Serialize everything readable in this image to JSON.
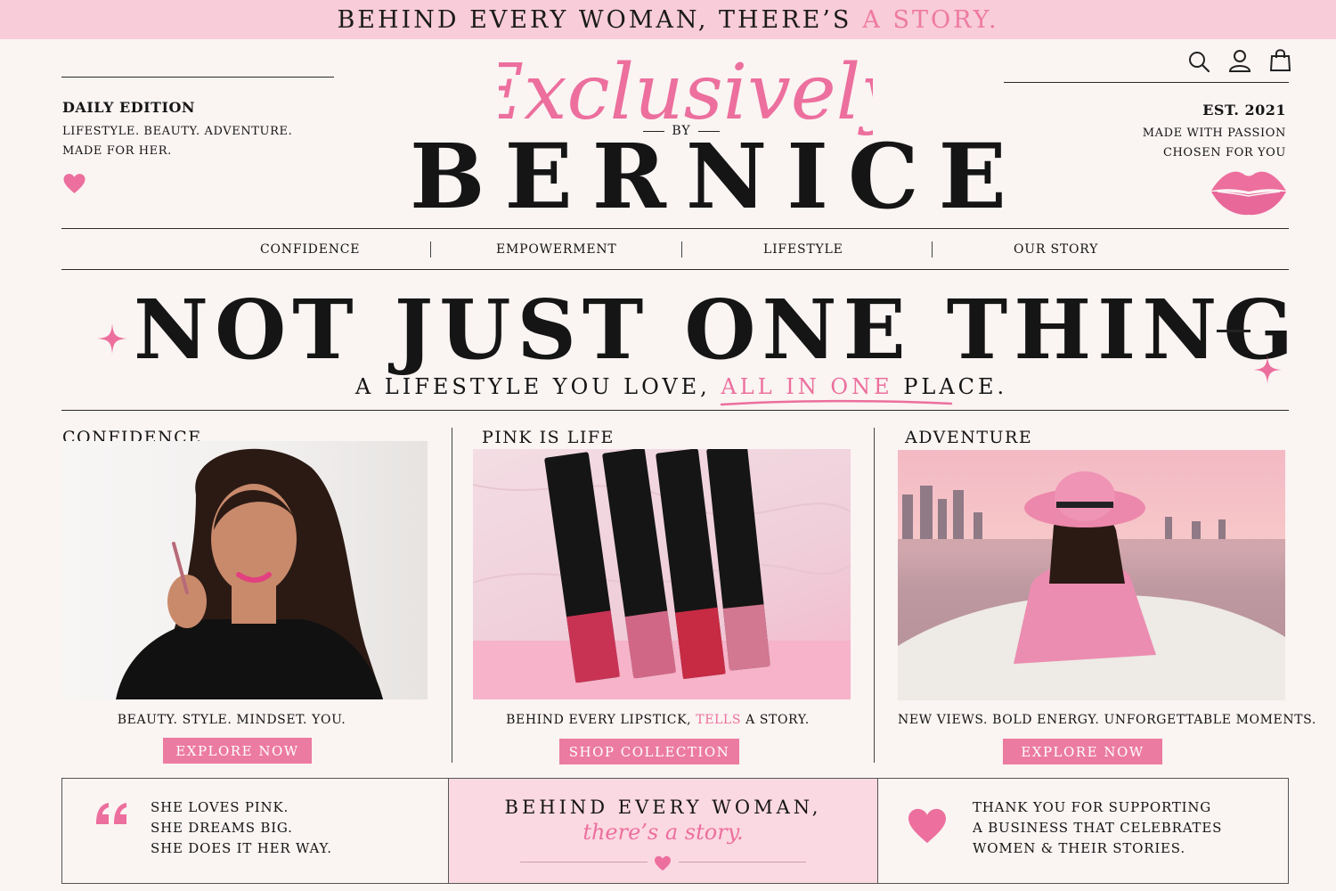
{
  "banner": {
    "text": "BEHIND EVERY WOMAN, THERE’S",
    "highlight": "A STORY."
  },
  "left_info": {
    "edition": "DAILY EDITION",
    "line1": "LIFESTYLE. BEAUTY. ADVENTURE.",
    "line2": "MADE FOR HER.",
    "icon": "heart-icon"
  },
  "logo": {
    "script": "Exclusively",
    "by": "BY",
    "name": "BERNICE"
  },
  "right_info": {
    "est": "EST. 2021",
    "line1": "MADE WITH PASSION",
    "line2": "CHOSEN FOR YOU",
    "icon": "lips-icon"
  },
  "header_icons": [
    "search-icon",
    "user-icon",
    "bag-icon"
  ],
  "nav": [
    "CONFIDENCE",
    "EMPOWERMENT",
    "LIFESTYLE",
    "OUR STORY"
  ],
  "hero": {
    "headline": "NOT JUST ONE THING",
    "sub_before": "A LIFESTYLE YOU LOVE,",
    "sub_highlight": "ALL IN ONE",
    "sub_after": "PLACE."
  },
  "columns": [
    {
      "title": "CONFIDENCE",
      "caption": "BEAUTY. STYLE. MINDSET. YOU.",
      "button": "EXPLORE NOW"
    },
    {
      "title": "PINK IS LIFE",
      "caption_before": "BEHIND EVERY LIPSTICK,",
      "caption_highlight": "TELLS",
      "caption_after": "A STORY.",
      "button": "SHOP COLLECTION",
      "product_label": "Pink is Life"
    },
    {
      "title": "ADVENTURE",
      "caption": "NEW VIEWS. BOLD ENERGY. UNFORGETTABLE MOMENTS.",
      "button": "EXPLORE NOW"
    }
  ],
  "footer": {
    "quote": [
      "SHE LOVES PINK.",
      "SHE DREAMS BIG.",
      "SHE DOES IT HER WAY."
    ],
    "center_title": "BEHIND EVERY WOMAN,",
    "center_script": "there’s a story.",
    "thanks": [
      "THANK YOU FOR SUPPORTING",
      "A BUSINESS THAT CELEBRATES",
      "WOMEN & THEIR STORIES."
    ]
  },
  "colors": {
    "accent": "#ec7ba1",
    "banner": "#f8ccd8",
    "background": "#faf4f3",
    "text": "#151515"
  }
}
